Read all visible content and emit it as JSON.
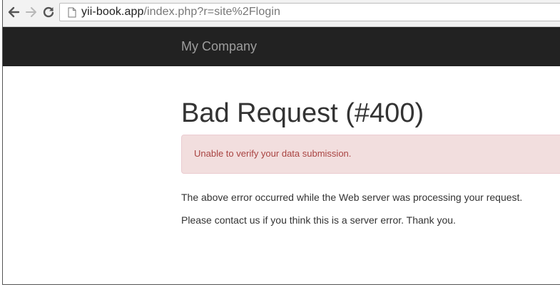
{
  "browser": {
    "url_host": "yii-book.app",
    "url_path": "/index.php?r=site%2Flogin"
  },
  "navbar": {
    "brand": "My Company"
  },
  "main": {
    "title": "Bad Request (#400)",
    "alert_message": "Unable to verify your data submission.",
    "paragraph_1": "The above error occurred while the Web server was processing your request.",
    "paragraph_2": "Please contact us if you think this is a server error. Thank you."
  },
  "colors": {
    "navbar_bg": "#222222",
    "brand_text": "#9d9d9d",
    "alert_bg": "#f2dede",
    "alert_border": "#ebccd1",
    "alert_text": "#a94442"
  },
  "icons": {
    "back": "arrow-left-icon",
    "forward": "arrow-right-icon",
    "reload": "reload-icon",
    "page": "page-icon"
  }
}
